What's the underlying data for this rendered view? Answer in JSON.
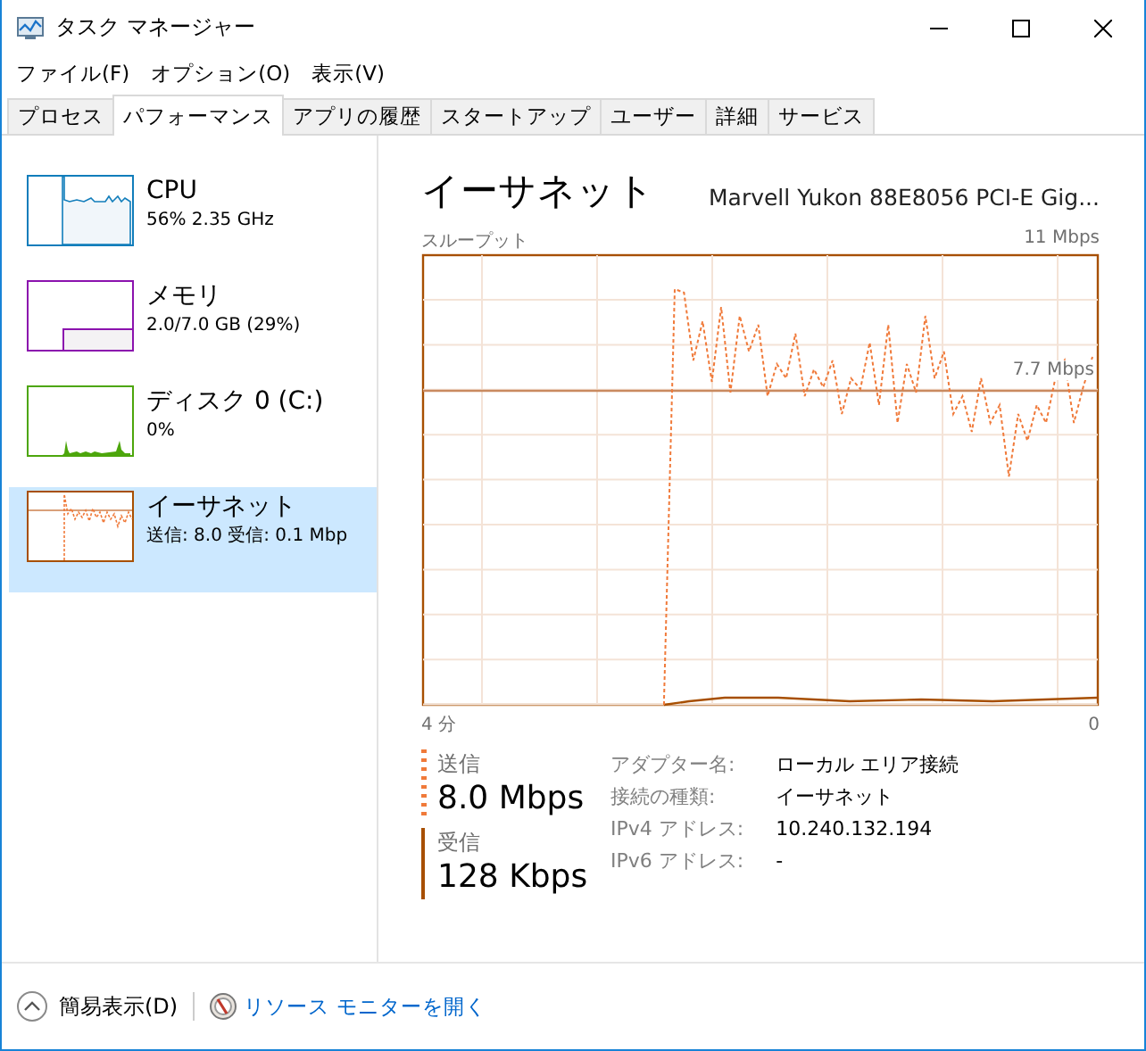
{
  "window": {
    "title": "タスク マネージャー"
  },
  "menu": [
    "ファイル(F)",
    "オプション(O)",
    "表示(V)"
  ],
  "tabs": [
    {
      "label": "プロセス",
      "selected": false
    },
    {
      "label": "パフォーマンス",
      "selected": true
    },
    {
      "label": "アプリの履歴",
      "selected": false
    },
    {
      "label": "スタートアップ",
      "selected": false
    },
    {
      "label": "ユーザー",
      "selected": false
    },
    {
      "label": "詳細",
      "selected": false
    },
    {
      "label": "サービス",
      "selected": false
    }
  ],
  "sidebar": {
    "items": [
      {
        "kind": "cpu",
        "name": "CPU",
        "detail": "56%  2.35 GHz",
        "color": "#117dbb",
        "selected": false
      },
      {
        "kind": "memory",
        "name": "メモリ",
        "detail": "2.0/7.0 GB (29%)",
        "color": "#8b12ae",
        "selected": false
      },
      {
        "kind": "disk",
        "name": "ディスク 0 (C:)",
        "detail": "0%",
        "color": "#4da60c",
        "selected": false
      },
      {
        "kind": "ethernet",
        "name": "イーサネット",
        "detail": "送信: 8.0 受信: 0.1 Mbp",
        "color": "#a74f01",
        "selected": true
      }
    ]
  },
  "detail": {
    "title": "イーサネット",
    "adapter": "Marvell Yukon 88E8056 PCI-E Gig...",
    "graph_label": "スループット",
    "graph_max": "11 Mbps",
    "graph_line_label": "7.7 Mbps",
    "time_start": "4 分",
    "time_end": "0",
    "stats": [
      {
        "kind": "send",
        "label": "送信",
        "value": "8.0 Mbps"
      },
      {
        "kind": "receive",
        "label": "受信",
        "value": "128 Kbps"
      }
    ],
    "properties": [
      {
        "label": "アダプター名:",
        "value": "ローカル エリア接続"
      },
      {
        "label": "接続の種類:",
        "value": "イーサネット"
      },
      {
        "label": "IPv4 アドレス:",
        "value": "10.240.132.194"
      },
      {
        "label": "IPv6 アドレス:",
        "value": "-"
      }
    ]
  },
  "footer": {
    "fewer_details": "簡易表示(D)",
    "resource_monitor": "リソース モニターを開く"
  }
}
